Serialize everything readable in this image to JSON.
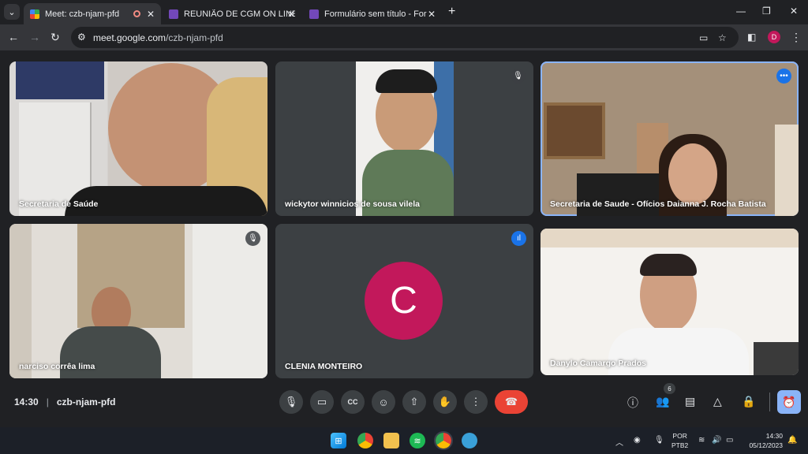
{
  "browser": {
    "tabs": [
      {
        "title": "Meet: czb-njam-pfd",
        "active": true,
        "recording": true
      },
      {
        "title": "REUNIÃO DE CGM ON LINE",
        "active": false
      },
      {
        "title": "Formulário sem título - Formulá",
        "active": false
      }
    ],
    "url_host": "meet.google.com",
    "url_path": "/czb-njam-pfd",
    "profile_initial": "D",
    "colors": {
      "chrome_bg": "#202124",
      "toolbar_bg": "#35363a",
      "forms_purple": "#7248b9"
    }
  },
  "meet": {
    "participants": [
      {
        "name": "Secretaria de Saúde",
        "video": true
      },
      {
        "name": "wickytor winnicios de sousa vilela",
        "video": true,
        "muted": true
      },
      {
        "name": "Secretaria de Saude - Ofícios Daianna J. Rocha Batista",
        "video": true,
        "pinned_options": true
      },
      {
        "name": "narciso corrêa lima",
        "video": true,
        "muted": true
      },
      {
        "name": "CLENIA MONTEIRO",
        "video": false,
        "initial": "C",
        "speaking": true,
        "avatar_color": "#c2185b"
      },
      {
        "name": "Danylo Camargo Prados",
        "video": true
      }
    ],
    "time": "14:30",
    "meeting_code": "czb-njam-pfd",
    "participant_count": "6",
    "colors": {
      "end_call": "#ea4335",
      "accent": "#8ab4f8",
      "speaking": "#1a73e8"
    }
  },
  "taskbar": {
    "lang_line1": "POR",
    "lang_line2": "PTB2",
    "clock_time": "14:30",
    "clock_date": "05/12/2023",
    "notification_count": "1"
  }
}
